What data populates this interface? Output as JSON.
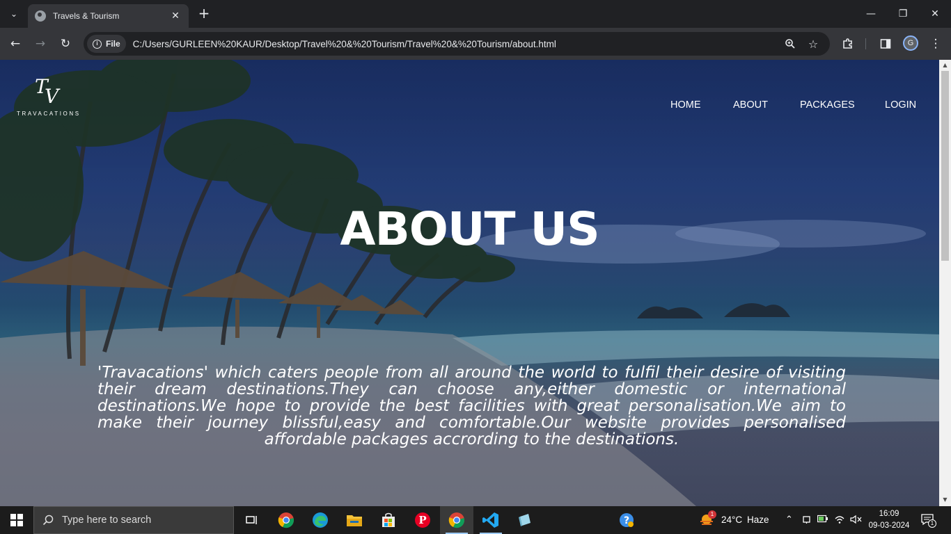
{
  "browser": {
    "tab_title": "Travels & Tourism",
    "tab_close": "✕",
    "new_tab": "+",
    "file_label": "File",
    "url": "C:/Users/GURLEEN%20KAUR/Desktop/Travel%20&%20Tourism/Travel%20&%20Tourism/about.html",
    "profile_initial": "G"
  },
  "page": {
    "logo_mark_t": "T",
    "logo_mark_v": "V",
    "logo_text": "TRAVACATIONS",
    "nav": [
      "HOME",
      "ABOUT",
      "PACKAGES",
      "LOGIN"
    ],
    "hero_title": "ABOUT US",
    "about_text": "'Travacations' which caters people from all around the world to fulfil their desire of visiting their dream destinations.They can choose any,either domestic or international destinations.We hope to provide the best facilities with great personalisation.We aim to make their journey blissful,easy and comfortable.Our website provides personalised affordable packages accrording to the destinations."
  },
  "taskbar": {
    "search_placeholder": "Type here to search",
    "weather_temp": "24°C",
    "weather_desc": "Haze",
    "weather_badge": "1",
    "time": "16:09",
    "date": "09-03-2024",
    "notification_count": "1"
  },
  "colors": {
    "chrome_bg": "#202124",
    "toolbar_bg": "#35363a",
    "taskbar_bg": "#1c1c1c",
    "accent_blue": "#8ab4f8"
  }
}
